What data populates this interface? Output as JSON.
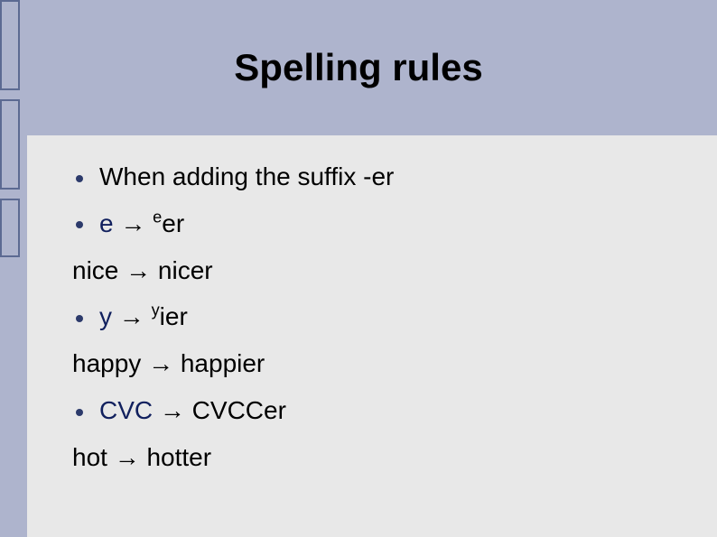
{
  "title": "Spelling rules",
  "lines": {
    "l1": "When adding the suffix -er",
    "l2_a": "e",
    "l2_arrow": " → ",
    "l2_sup": "e",
    "l2_b": "er",
    "l3": "nice → nicer",
    "l4_a": "y",
    "l4_arrow": " → ",
    "l4_sup": "y",
    "l4_b": "ier",
    "l5": "happy → happier",
    "l6_a": "CVC",
    "l6_arrow": " → CVCCer",
    "l7": "hot → hotter"
  }
}
